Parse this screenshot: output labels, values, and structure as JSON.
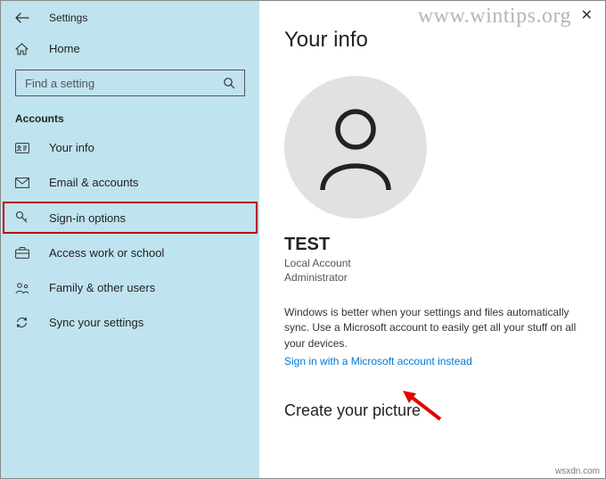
{
  "window": {
    "title": "Settings",
    "close": "✕"
  },
  "sidebar": {
    "home": "Home",
    "search_placeholder": "Find a setting",
    "section": "Accounts",
    "items": [
      {
        "icon": "id-card-icon",
        "label": "Your info"
      },
      {
        "icon": "mail-icon",
        "label": "Email & accounts"
      },
      {
        "icon": "key-icon",
        "label": "Sign-in options"
      },
      {
        "icon": "briefcase-icon",
        "label": "Access work or school"
      },
      {
        "icon": "family-icon",
        "label": "Family & other users"
      },
      {
        "icon": "sync-icon",
        "label": "Sync your settings"
      }
    ]
  },
  "main": {
    "title": "Your info",
    "username": "TEST",
    "account_type_line1": "Local Account",
    "account_type_line2": "Administrator",
    "blurb": "Windows is better when your settings and files automatically sync. Use a Microsoft account to easily get all your stuff on all your devices.",
    "link": "Sign in with a Microsoft account instead",
    "section2": "Create your picture"
  },
  "watermark": "www.wintips.org",
  "attribution": "wsxdn.com"
}
